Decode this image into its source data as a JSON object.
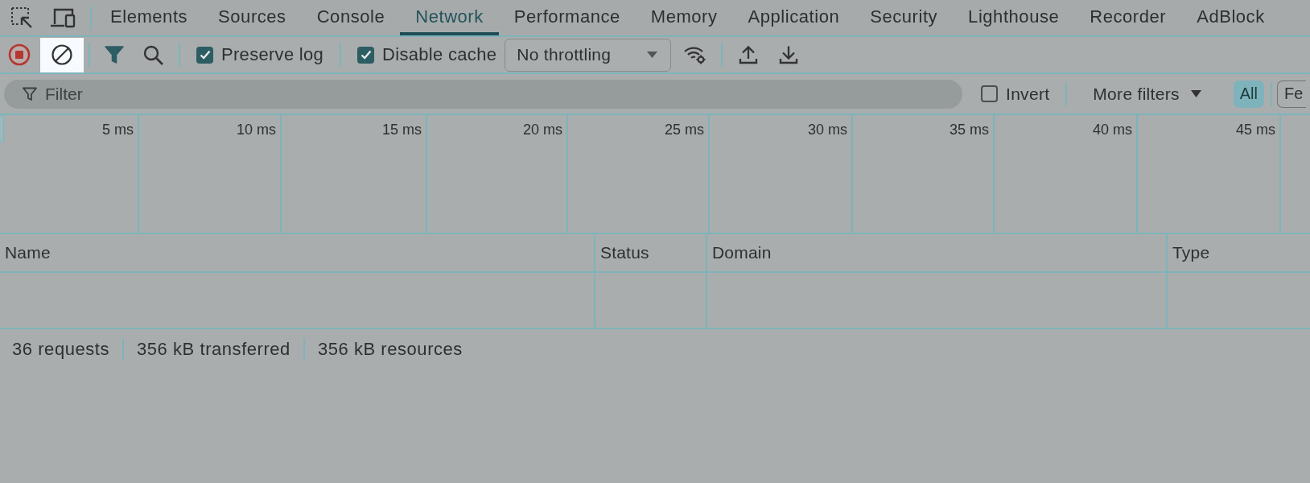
{
  "tab_bar": {
    "tabs": [
      {
        "label": "Elements",
        "selected": false
      },
      {
        "label": "Sources",
        "selected": false
      },
      {
        "label": "Console",
        "selected": false
      },
      {
        "label": "Network",
        "selected": true
      },
      {
        "label": "Performance",
        "selected": false
      },
      {
        "label": "Memory",
        "selected": false
      },
      {
        "label": "Application",
        "selected": false
      },
      {
        "label": "Security",
        "selected": false
      },
      {
        "label": "Lighthouse",
        "selected": false
      },
      {
        "label": "Recorder",
        "selected": false
      },
      {
        "label": "AdBlock",
        "selected": false
      }
    ]
  },
  "toolbar": {
    "record_button": {
      "recording": true
    },
    "clear_button": {
      "highlighted": true
    },
    "filter_toggle": {
      "on": true
    },
    "checkboxes": [
      {
        "label": "Preserve log",
        "checked": true
      },
      {
        "label": "Disable cache",
        "checked": true
      }
    ],
    "throttling": {
      "value": "No throttling"
    }
  },
  "filter_bar": {
    "filter": {
      "placeholder": "Filter"
    },
    "invert": {
      "label": "Invert",
      "checked": false
    },
    "more_filters": {
      "label": "More filters"
    },
    "type_filters": [
      {
        "label": "All",
        "selected": true
      },
      {
        "label": "Fe",
        "selected": false
      }
    ]
  },
  "timeline": {
    "ticks": [
      "5 ms",
      "10 ms",
      "15 ms",
      "20 ms",
      "25 ms",
      "30 ms",
      "35 ms",
      "40 ms",
      "45 ms"
    ]
  },
  "table": {
    "columns": [
      "Name",
      "Status",
      "Domain",
      "Type"
    ]
  },
  "status_bar": {
    "items": [
      "36 requests",
      "356 kB transferred",
      "356 kB resources"
    ]
  }
}
